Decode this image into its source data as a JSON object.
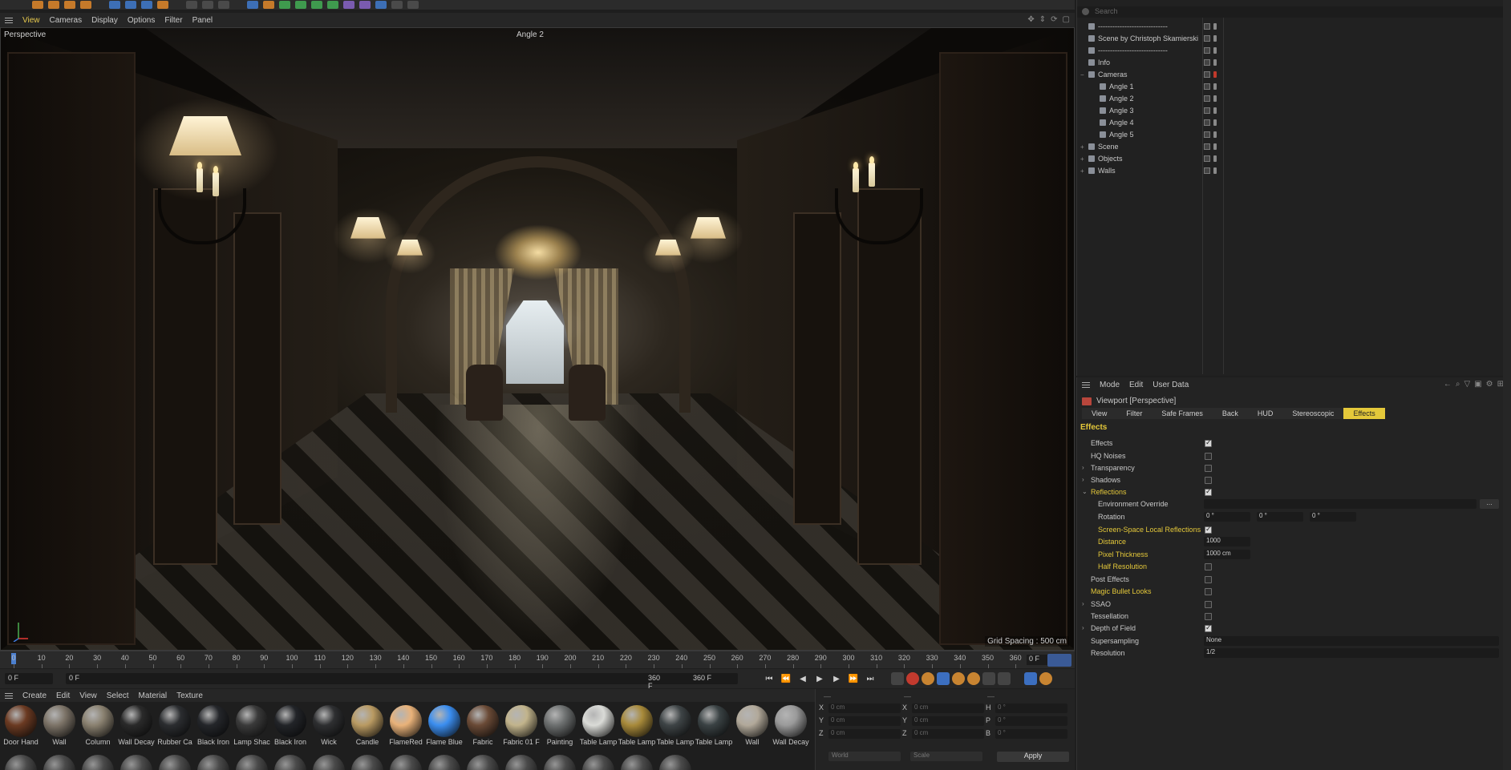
{
  "viewport": {
    "menu": [
      "View",
      "Cameras",
      "Display",
      "Options",
      "Filter",
      "Panel"
    ],
    "label": "Perspective",
    "camera": "Angle 2",
    "grid_spacing": "Grid Spacing : 500 cm"
  },
  "timeline": {
    "ticks": [
      "0",
      "10",
      "20",
      "30",
      "40",
      "50",
      "60",
      "70",
      "80",
      "90",
      "100",
      "110",
      "120",
      "130",
      "140",
      "150",
      "160",
      "170",
      "180",
      "190",
      "200",
      "210",
      "220",
      "230",
      "240",
      "250",
      "260",
      "270",
      "280",
      "290",
      "300",
      "310",
      "320",
      "330",
      "340",
      "350",
      "360"
    ],
    "current_frame": "0 F",
    "start_field": "0 F",
    "min_field": "0 F",
    "end_field": "360 F",
    "max_field": "360 F"
  },
  "material_manager": {
    "menu": [
      "Create",
      "Edit",
      "View",
      "Select",
      "Material",
      "Texture"
    ],
    "materials": [
      {
        "name": "Door Hand",
        "color": "#6b3a22"
      },
      {
        "name": "Wall",
        "color": "#7d7468"
      },
      {
        "name": "Column",
        "color": "#8a8170"
      },
      {
        "name": "Wall Decay",
        "color": "#2a2a2a"
      },
      {
        "name": "Rubber Ca",
        "color": "#2b2d30"
      },
      {
        "name": "Black Iron",
        "color": "#24262a"
      },
      {
        "name": "Lamp Shac",
        "color": "#3a3a3a"
      },
      {
        "name": "Black Iron",
        "color": "#222428"
      },
      {
        "name": "Wick",
        "color": "#2e2f31"
      },
      {
        "name": "Candle",
        "color": "#b99a62"
      },
      {
        "name": "FlameRed",
        "color": "#e9b279"
      },
      {
        "name": "Flame Blue",
        "color": "#3b8ef0"
      },
      {
        "name": "Fabric",
        "color": "#6a4a36"
      },
      {
        "name": "Fabric 01 F",
        "color": "#c2b48c"
      },
      {
        "name": "Painting",
        "color": "#6d7070"
      },
      {
        "name": "Table Lamp",
        "color": "#dadbd7"
      },
      {
        "name": "Table Lamp",
        "color": "#a88a3a"
      },
      {
        "name": "Table Lamp",
        "color": "#3e4446"
      },
      {
        "name": "Table Lamp",
        "color": "#3a4244"
      },
      {
        "name": "Wall",
        "color": "#b2a99a"
      },
      {
        "name": "Wall Decay",
        "color": "#9a9a9a"
      }
    ]
  },
  "coordinates": {
    "rows": [
      {
        "a": "X",
        "av": "0 cm",
        "b": "X",
        "bv": "0 cm",
        "c": "H",
        "cv": "0 °"
      },
      {
        "a": "Y",
        "av": "0 cm",
        "b": "Y",
        "bv": "0 cm",
        "c": "P",
        "cv": "0 °"
      },
      {
        "a": "Z",
        "av": "0 cm",
        "b": "Z",
        "bv": "0 cm",
        "c": "B",
        "cv": "0 °"
      }
    ],
    "mode1": "World",
    "mode2": "Scale",
    "apply": "Apply"
  },
  "object_manager": {
    "search_placeholder": "Search",
    "objects": [
      {
        "name": "-----------------------------",
        "indent": 0,
        "expand": ""
      },
      {
        "name": "Scene by Christoph Skamierski",
        "indent": 0,
        "expand": ""
      },
      {
        "name": "-----------------------------",
        "indent": 0,
        "expand": ""
      },
      {
        "name": "Info",
        "indent": 0,
        "expand": ""
      },
      {
        "name": "Cameras",
        "indent": 0,
        "expand": "−"
      },
      {
        "name": "Angle 1",
        "indent": 1,
        "expand": ""
      },
      {
        "name": "Angle 2",
        "indent": 1,
        "expand": ""
      },
      {
        "name": "Angle 3",
        "indent": 1,
        "expand": ""
      },
      {
        "name": "Angle 4",
        "indent": 1,
        "expand": ""
      },
      {
        "name": "Angle 5",
        "indent": 1,
        "expand": ""
      },
      {
        "name": "Scene",
        "indent": 0,
        "expand": "+"
      },
      {
        "name": "Objects",
        "indent": 0,
        "expand": "+"
      },
      {
        "name": "Walls",
        "indent": 0,
        "expand": "+"
      }
    ]
  },
  "attribute_manager": {
    "menu": [
      "Mode",
      "Edit",
      "User Data"
    ],
    "title": "Viewport [Perspective]",
    "tabs": [
      "View",
      "Filter",
      "Safe Frames",
      "Back",
      "HUD",
      "Stereoscopic",
      "Effects"
    ],
    "active_tab": "Effects",
    "section": "Effects",
    "rows": [
      {
        "label": "Effects",
        "indent": 0,
        "arrow": "",
        "checked": true
      },
      {
        "label": "HQ Noises",
        "indent": 0,
        "arrow": "",
        "checked": false
      },
      {
        "label": "Transparency",
        "indent": 0,
        "arrow": "›",
        "checked": false
      },
      {
        "label": "Shadows",
        "indent": 0,
        "arrow": "›",
        "checked": false
      },
      {
        "label": "Reflections",
        "indent": 0,
        "arrow": "⌄",
        "checked": true,
        "hl": true
      },
      {
        "label": "Environment Override",
        "indent": 1,
        "arrow": "",
        "kind": "long"
      },
      {
        "label": "Rotation",
        "indent": 1,
        "arrow": "",
        "kind": "triple",
        "values": [
          "0 °",
          "0 °",
          "0 °"
        ]
      },
      {
        "label": "Screen-Space Local Reflections",
        "indent": 1,
        "arrow": "",
        "checked": true,
        "hl": true
      },
      {
        "label": "Distance",
        "indent": 1,
        "arrow": "",
        "kind": "num",
        "value": "1000",
        "hl": true
      },
      {
        "label": "Pixel Thickness",
        "indent": 1,
        "arrow": "",
        "kind": "num",
        "value": "1000 cm",
        "hl": true
      },
      {
        "label": "Half Resolution",
        "indent": 1,
        "arrow": "",
        "checked": false,
        "hl": true
      },
      {
        "label": "Post Effects",
        "indent": 0,
        "arrow": "",
        "checked": false
      },
      {
        "label": "Magic Bullet Looks",
        "indent": 0,
        "arrow": "",
        "checked": false,
        "hl": true
      },
      {
        "label": "SSAO",
        "indent": 0,
        "arrow": "›",
        "checked": false
      },
      {
        "label": "Tessellation",
        "indent": 0,
        "arrow": "",
        "checked": false
      },
      {
        "label": "Depth of Field",
        "indent": 0,
        "arrow": "›",
        "checked": true
      },
      {
        "label": "Supersampling",
        "indent": 0,
        "arrow": "",
        "kind": "select",
        "value": "None"
      },
      {
        "label": "Resolution",
        "indent": 0,
        "arrow": "",
        "kind": "select",
        "value": "1/2"
      }
    ]
  }
}
